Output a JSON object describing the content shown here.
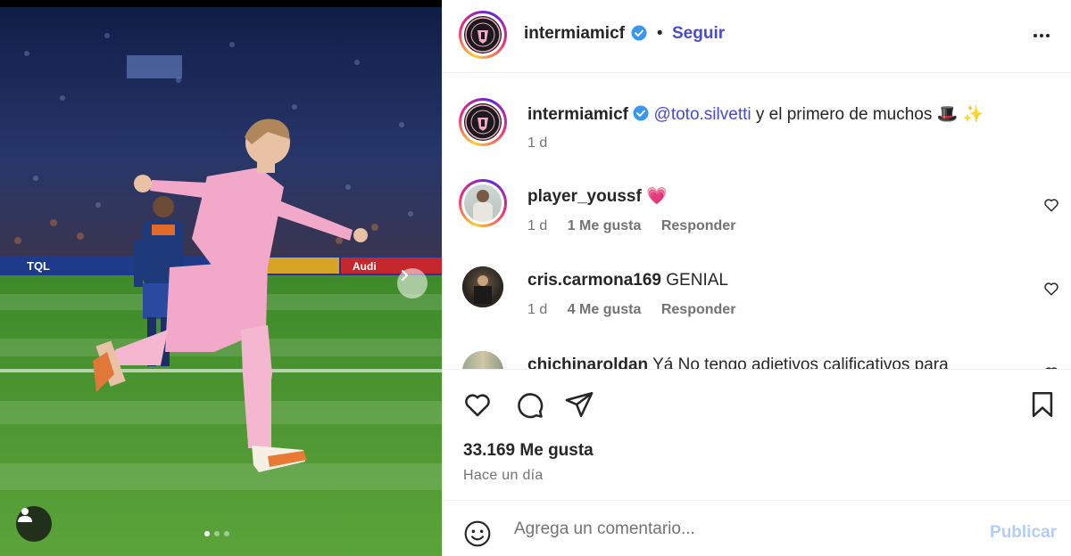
{
  "header": {
    "username": "intermiamicf",
    "separator": "•",
    "follow_label": "Seguir",
    "more_icon": "more-horizontal-icon"
  },
  "caption": {
    "username": "intermiamicf",
    "mention": "@toto.silvetti",
    "text": " y el primero de muchos 🎩 ✨",
    "age": "1 d"
  },
  "comments": [
    {
      "username": "player_youssf",
      "text": "💗",
      "age": "1 d",
      "likes": "1 Me gusta",
      "reply": "Responder"
    },
    {
      "username": "cris.carmona169",
      "text": "GENIAL",
      "age": "1 d",
      "likes": "4 Me gusta",
      "reply": "Responder"
    },
    {
      "username": "chichinaroldan",
      "text": "Yá No tengo adjetivos calificativos para"
    }
  ],
  "stats": {
    "likes": "33.169 Me gusta",
    "posted": "Hace un día"
  },
  "composer": {
    "placeholder": "Agrega un comentario...",
    "publish_label": "Publicar"
  },
  "carousel": {
    "current": 1,
    "total": 3
  },
  "colors": {
    "link": "#4a4ad1",
    "publish_disabled": "#b3cdf9",
    "muted": "#737373",
    "shirt_pink": "#f2a9c9"
  }
}
